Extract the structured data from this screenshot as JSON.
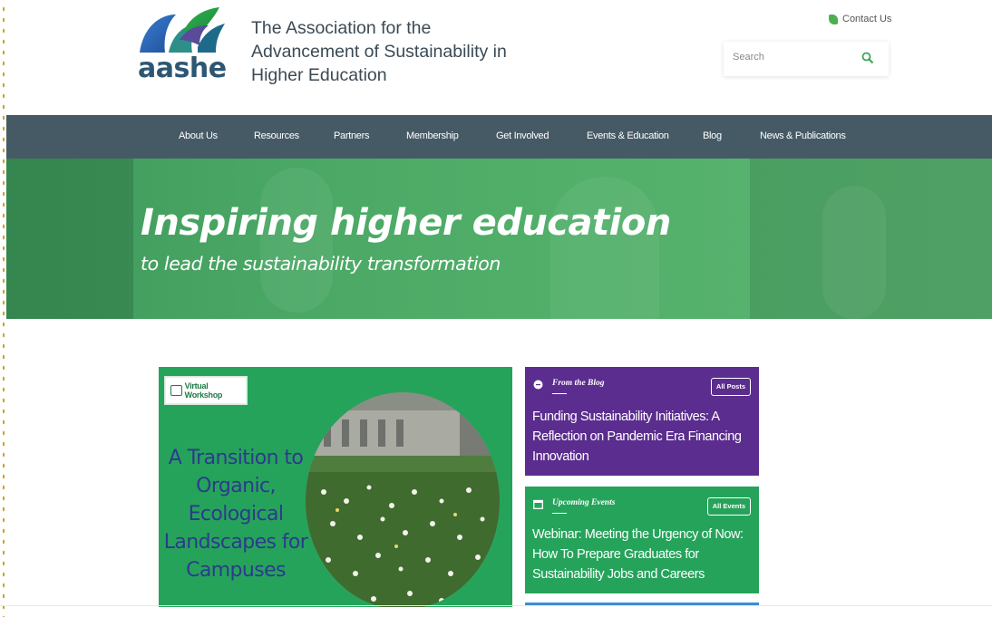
{
  "header": {
    "logo_text": "aashe",
    "org_title": "The Association for the Advancement of Sustainability in Higher Education",
    "contact_label": "Contact Us",
    "search_placeholder": "Search"
  },
  "nav": {
    "items": [
      {
        "label": "About Us"
      },
      {
        "label": "Resources"
      },
      {
        "label": "Partners"
      },
      {
        "label": "Membership"
      },
      {
        "label": "Get Involved"
      },
      {
        "label": "Events & Education"
      },
      {
        "label": "Blog"
      },
      {
        "label": "News & Publications"
      }
    ]
  },
  "hero": {
    "title": "Inspiring higher education",
    "subtitle": "to lead the sustainability transformation"
  },
  "feature": {
    "badge": "Virtual Workshop",
    "title": "A Transition to Organic, Ecological Landscapes for Campuses"
  },
  "blog_card": {
    "label": "From the Blog",
    "button": "All Posts",
    "text": "Funding Sustainability Initiatives: A Reflection on Pandemic Era Financing Innovation"
  },
  "events_card": {
    "label": "Upcoming Events",
    "button": "All Events",
    "text": "Webinar: Meeting the Urgency of Now: How To Prepare Graduates for Sustainability Jobs and Careers"
  },
  "colors": {
    "nav": "#465a66",
    "hero_green": "#4caa66",
    "feature_green": "#26a35b",
    "blog_purple": "#5b2d8e",
    "title_blue": "#2b3b8c"
  },
  "icons": [
    "leaf-icon",
    "search-icon",
    "workshop-icon",
    "chat-icon",
    "calendar-icon"
  ]
}
